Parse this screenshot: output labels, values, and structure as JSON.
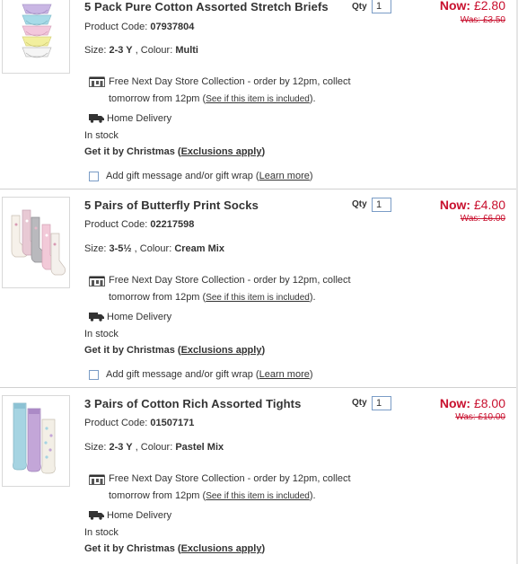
{
  "items": [
    {
      "title": "5 Pack Pure Cotton Assorted Stretch Briefs",
      "code_label": "Product Code:",
      "code": "07937804",
      "size_label": "Size:",
      "size": "2-3 Y",
      "colour_label": ", Colour:",
      "colour": "Multi",
      "qty_label": "Qty",
      "qty": "1",
      "now_label": "Now:",
      "now_price": "£2.80",
      "was_price": "Was: £3.50",
      "collect_icon": "store-collection-icon",
      "collect_text1": "Free Next Day Store Collection - order by 12pm, collect",
      "collect_text2a": "tomorrow from 12pm (",
      "collect_link": "See if this item is included",
      "collect_text2b": ").",
      "delivery_icon": "delivery-van-icon",
      "delivery": "Home Delivery",
      "stock": "In stock",
      "xmas_a": "Get it by Christmas (",
      "xmas_link": "Exclusions apply",
      "xmas_b": ")",
      "gift_a": "Add gift message and/or gift wrap (",
      "gift_link": "Learn more",
      "gift_b": ")"
    },
    {
      "title": "5 Pairs of Butterfly Print Socks",
      "code_label": "Product Code:",
      "code": "02217598",
      "size_label": "Size:",
      "size": "3-5½",
      "colour_label": ", Colour:",
      "colour": "Cream Mix",
      "qty_label": "Qty",
      "qty": "1",
      "now_label": "Now:",
      "now_price": "£4.80",
      "was_price": "Was: £6.00",
      "collect_icon": "store-collection-icon",
      "collect_text1": "Free Next Day Store Collection - order by 12pm, collect",
      "collect_text2a": "tomorrow from 12pm (",
      "collect_link": "See if this item is included",
      "collect_text2b": ").",
      "delivery_icon": "delivery-van-icon",
      "delivery": "Home Delivery",
      "stock": "In stock",
      "xmas_a": "Get it by Christmas (",
      "xmas_link": "Exclusions apply",
      "xmas_b": ")",
      "gift_a": "Add gift message and/or gift wrap (",
      "gift_link": "Learn more",
      "gift_b": ")"
    },
    {
      "title": "3 Pairs of Cotton Rich Assorted Tights",
      "code_label": "Product Code:",
      "code": "01507171",
      "size_label": "Size:",
      "size": "2-3 Y",
      "colour_label": ", Colour:",
      "colour": "Pastel Mix",
      "qty_label": "Qty",
      "qty": "1",
      "now_label": "Now:",
      "now_price": "£8.00",
      "was_price": "Was: £10.00",
      "collect_icon": "store-collection-icon",
      "collect_text1": "Free Next Day Store Collection - order by 12pm, collect",
      "collect_text2a": "tomorrow from 12pm (",
      "collect_link": "See if this item is included",
      "collect_text2b": ").",
      "delivery_icon": "delivery-van-icon",
      "delivery": "Home Delivery",
      "stock": "In stock",
      "xmas_a": "Get it by Christmas (",
      "xmas_link": "Exclusions apply",
      "xmas_b": ")"
    }
  ],
  "colors": {
    "price_red": "#c8102e",
    "text": "#333333",
    "input_border": "#7a9cc6"
  }
}
